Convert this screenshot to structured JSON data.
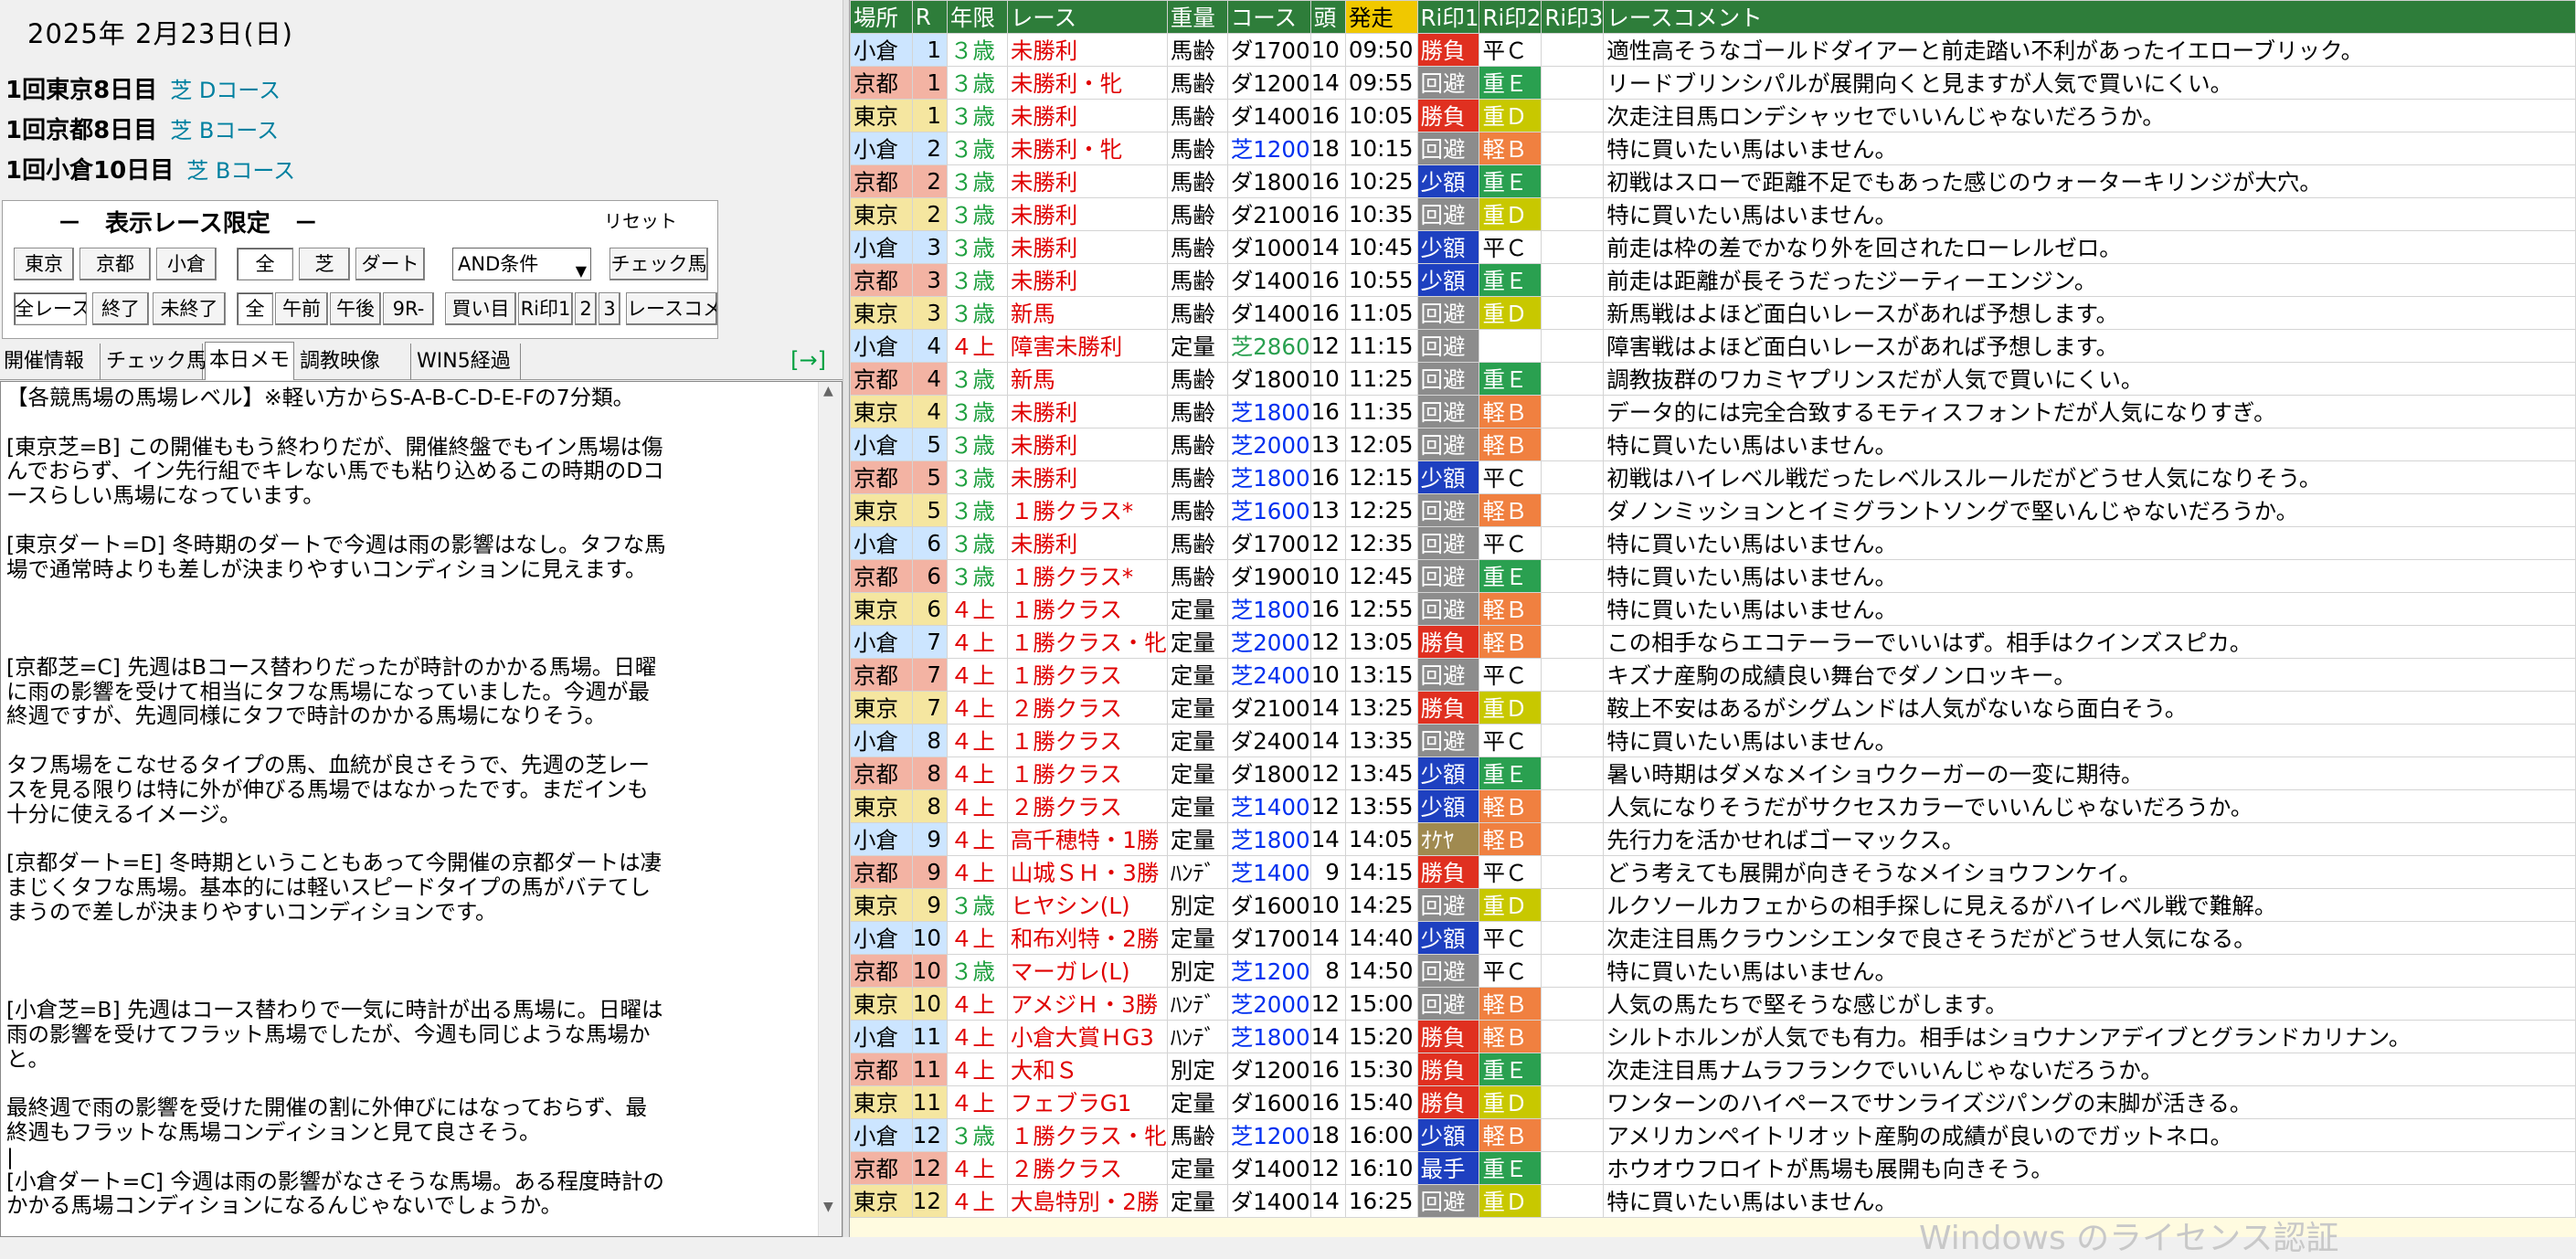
{
  "date": "2025年 2月23日(日)",
  "meetings": [
    {
      "name": "1回東京8日目",
      "course": "芝 Dコース"
    },
    {
      "name": "1回京都8日目",
      "course": "芝 Bコース"
    },
    {
      "name": "1回小倉10日目",
      "course": "芝 Bコース"
    }
  ],
  "filter": {
    "title": "－　表示レース限定　－",
    "reset": "リセット",
    "row1": [
      "東京",
      "京都",
      "小倉",
      "全",
      "芝",
      "ダート"
    ],
    "condition": "AND条件",
    "check_horse": "チェック馬",
    "row2": [
      "全レース",
      "終了",
      "未終了",
      "全",
      "午前",
      "午後",
      "9R-",
      "買い目",
      "Ri印1",
      "2",
      "3",
      "レースコメ"
    ]
  },
  "tabs": [
    "開催情報",
    "チェック馬",
    "本日メモ",
    "調教映像",
    "WIN5経過"
  ],
  "tab_arrow": "[→]",
  "memo": [
    "【各競馬場の馬場レベル】※軽い方からS-A-B-C-D-E-Fの7分類。",
    "",
    "[東京芝=B] この開催ももう終わりだが、開催終盤でもイン馬場は傷",
    "んでおらず、イン先行組でキレない馬でも粘り込めるこの時期のDコ",
    "ースらしい馬場になっています。",
    "",
    "[東京ダート=D] 冬時期のダートで今週は雨の影響はなし。タフな馬",
    "場で通常時よりも差しが決まりやすいコンディションに見えます。",
    "",
    "",
    "",
    "[京都芝=C] 先週はBコース替わりだったが時計のかかる馬場。日曜",
    "に雨の影響を受けて相当にタフな馬場になっていました。今週が最",
    "終週ですが、先週同様にタフで時計のかかる馬場になりそう。",
    "",
    "タフ馬場をこなせるタイプの馬、血統が良さそうで、先週の芝レー",
    "スを見る限りは特に外が伸びる馬場ではなかったです。まだインも",
    "十分に使えるイメージ。",
    "",
    "[京都ダート=E] 冬時期ということもあって今開催の京都ダートは凄",
    "まじくタフな馬場。基本的には軽いスピードタイプの馬がバテてし",
    "まうので差しが決まりやすいコンディションです。",
    "",
    "",
    "",
    "[小倉芝=B] 先週はコース替わりで一気に時計が出る馬場に。日曜は",
    "雨の影響を受けてフラット馬場でしたが、今週も同じような馬場か",
    "と。",
    "",
    "最終週で雨の影響を受けた開催の割に外伸びにはなっておらず、最",
    "終週もフラットな馬場コンディションと見て良さそう。",
    "|",
    "[小倉ダート=C] 今週は雨の影響がなさそうな馬場。ある程度時計の",
    "かかる馬場コンディションになるんじゃないでしょうか。"
  ],
  "table": {
    "headers": [
      "場所",
      "R",
      "年限",
      "レース",
      "重量",
      "コース",
      "頭",
      "発走",
      "Ri印1",
      "Ri印2",
      "Ri印3",
      "レースコメント"
    ],
    "rows": [
      [
        "小倉",
        "1",
        "３歳",
        "未勝利",
        "馬齢",
        "ダ1700",
        "10",
        "09:50",
        "勝負",
        "平Ｃ",
        "",
        "適性高そうなゴールドダイアーと前走踏い不利があったイエローブリック。"
      ],
      [
        "京都",
        "1",
        "３歳",
        "未勝利・牝",
        "馬齢",
        "ダ1200",
        "14",
        "09:55",
        "回避",
        "重Ｅ",
        "",
        "リードブリンシパルが展開向くと見ますが人気で買いにくい。"
      ],
      [
        "東京",
        "1",
        "３歳",
        "未勝利",
        "馬齢",
        "ダ1400",
        "16",
        "10:05",
        "勝負",
        "重Ｄ",
        "",
        "次走注目馬ロンデシャッセでいいんじゃないだろうか。"
      ],
      [
        "小倉",
        "2",
        "３歳",
        "未勝利・牝",
        "馬齢",
        "芝1200",
        "18",
        "10:15",
        "回避",
        "軽Ｂ",
        "",
        "特に買いたい馬はいません。"
      ],
      [
        "京都",
        "2",
        "３歳",
        "未勝利",
        "馬齢",
        "ダ1800",
        "16",
        "10:25",
        "少額",
        "重Ｅ",
        "",
        "初戦はスローで距離不足でもあった感じのウォーターキリンジが大穴。"
      ],
      [
        "東京",
        "2",
        "３歳",
        "未勝利",
        "馬齢",
        "ダ2100",
        "16",
        "10:35",
        "回避",
        "重Ｄ",
        "",
        "特に買いたい馬はいません。"
      ],
      [
        "小倉",
        "3",
        "３歳",
        "未勝利",
        "馬齢",
        "ダ1000",
        "14",
        "10:45",
        "少額",
        "平Ｃ",
        "",
        "前走は枠の差でかなり外を回されたローレルゼロ。"
      ],
      [
        "京都",
        "3",
        "３歳",
        "未勝利",
        "馬齢",
        "ダ1400",
        "16",
        "10:55",
        "少額",
        "重Ｅ",
        "",
        "前走は距離が長そうだったジーティーエンジン。"
      ],
      [
        "東京",
        "3",
        "３歳",
        "新馬",
        "馬齢",
        "ダ1400",
        "16",
        "11:05",
        "回避",
        "重Ｄ",
        "",
        "新馬戦はよほど面白いレースがあれば予想します。"
      ],
      [
        "小倉",
        "4",
        "４上",
        "障害未勝利",
        "定量",
        "芝2860",
        "12",
        "11:15",
        "回避",
        "",
        "",
        "障害戦はよほど面白いレースがあれば予想します。"
      ],
      [
        "京都",
        "4",
        "３歳",
        "新馬",
        "馬齢",
        "ダ1800",
        "10",
        "11:25",
        "回避",
        "重Ｅ",
        "",
        "調教抜群のワカミヤプリンスだが人気で買いにくい。"
      ],
      [
        "東京",
        "4",
        "３歳",
        "未勝利",
        "馬齢",
        "芝1800",
        "16",
        "11:35",
        "回避",
        "軽Ｂ",
        "",
        "データ的には完全合致するモティスフォントだが人気になりすぎ。"
      ],
      [
        "小倉",
        "5",
        "３歳",
        "未勝利",
        "馬齢",
        "芝2000",
        "13",
        "12:05",
        "回避",
        "軽Ｂ",
        "",
        "特に買いたい馬はいません。"
      ],
      [
        "京都",
        "5",
        "３歳",
        "未勝利",
        "馬齢",
        "芝1800",
        "16",
        "12:15",
        "少額",
        "平Ｃ",
        "",
        "初戦はハイレベル戦だったレベルスルールだがどうせ人気になりそう。"
      ],
      [
        "東京",
        "5",
        "３歳",
        "１勝クラス*",
        "馬齢",
        "芝1600",
        "13",
        "12:25",
        "回避",
        "軽Ｂ",
        "",
        "ダノンミッションとイミグラントソングで堅いんじゃないだろうか。"
      ],
      [
        "小倉",
        "6",
        "３歳",
        "未勝利",
        "馬齢",
        "ダ1700",
        "12",
        "12:35",
        "回避",
        "平Ｃ",
        "",
        "特に買いたい馬はいません。"
      ],
      [
        "京都",
        "6",
        "３歳",
        "１勝クラス*",
        "馬齢",
        "ダ1900",
        "10",
        "12:45",
        "回避",
        "重Ｅ",
        "",
        "特に買いたい馬はいません。"
      ],
      [
        "東京",
        "6",
        "４上",
        "１勝クラス",
        "定量",
        "芝1800",
        "16",
        "12:55",
        "回避",
        "軽Ｂ",
        "",
        "特に買いたい馬はいません。"
      ],
      [
        "小倉",
        "7",
        "４上",
        "１勝クラス・牝",
        "定量",
        "芝2000",
        "12",
        "13:05",
        "勝負",
        "軽Ｂ",
        "",
        "この相手ならエコテーラーでいいはず。相手はクインズスピカ。"
      ],
      [
        "京都",
        "7",
        "４上",
        "１勝クラス",
        "定量",
        "芝2400",
        "10",
        "13:15",
        "回避",
        "平Ｃ",
        "",
        "キズナ産駒の成績良い舞台でダノンロッキー。"
      ],
      [
        "東京",
        "7",
        "４上",
        "２勝クラス",
        "定量",
        "ダ2100",
        "14",
        "13:25",
        "勝負",
        "重Ｄ",
        "",
        "鞍上不安はあるがシグムンドは人気がないなら面白そう。"
      ],
      [
        "小倉",
        "8",
        "４上",
        "１勝クラス",
        "定量",
        "ダ2400",
        "14",
        "13:35",
        "回避",
        "平Ｃ",
        "",
        "特に買いたい馬はいません。"
      ],
      [
        "京都",
        "8",
        "４上",
        "１勝クラス",
        "定量",
        "ダ1800",
        "12",
        "13:45",
        "少額",
        "重Ｅ",
        "",
        "暑い時期はダメなメイショウクーガーの一変に期待。"
      ],
      [
        "東京",
        "8",
        "４上",
        "２勝クラス",
        "定量",
        "芝1400",
        "12",
        "13:55",
        "少額",
        "軽Ｂ",
        "",
        "人気になりそうだがサクセスカラーでいいんじゃないだろうか。"
      ],
      [
        "小倉",
        "9",
        "４上",
        "高千穂特・1勝",
        "定量",
        "芝1800",
        "14",
        "14:05",
        "ｵｹﾔ",
        "軽Ｂ",
        "",
        "先行力を活かせればゴーマックス。"
      ],
      [
        "京都",
        "9",
        "４上",
        "山城ＳＨ・3勝",
        "ﾊﾝﾃﾞ",
        "芝1400",
        "9",
        "14:15",
        "勝負",
        "平Ｃ",
        "",
        "どう考えても展開が向きそうなメイショウフンケイ。"
      ],
      [
        "東京",
        "9",
        "３歳",
        "ヒヤシン(L)",
        "別定",
        "ダ1600",
        "10",
        "14:25",
        "回避",
        "重Ｄ",
        "",
        "ルクソールカフェからの相手探しに見えるがハイレベル戦で難解。"
      ],
      [
        "小倉",
        "10",
        "４上",
        "和布刈特・2勝",
        "定量",
        "ダ1700",
        "14",
        "14:40",
        "少額",
        "平Ｃ",
        "",
        "次走注目馬クラウンシエンタで良さそうだがどうせ人気になる。"
      ],
      [
        "京都",
        "10",
        "３歳",
        "マーガレ(L)",
        "別定",
        "芝1200",
        "8",
        "14:50",
        "回避",
        "平Ｃ",
        "",
        "特に買いたい馬はいません。"
      ],
      [
        "東京",
        "10",
        "４上",
        "アメジＨ・3勝",
        "ﾊﾝﾃﾞ",
        "芝2000",
        "12",
        "15:00",
        "回避",
        "軽Ｂ",
        "",
        "人気の馬たちで堅そうな感じがします。"
      ],
      [
        "小倉",
        "11",
        "４上",
        "小倉大賞ＨG3",
        "ﾊﾝﾃﾞ",
        "芝1800",
        "14",
        "15:20",
        "勝負",
        "軽Ｂ",
        "",
        "シルトホルンが人気でも有力。相手はショウナンアデイブとグランドカリナン。"
      ],
      [
        "京都",
        "11",
        "４上",
        "大和Ｓ",
        "別定",
        "ダ1200",
        "16",
        "15:30",
        "勝負",
        "重Ｅ",
        "",
        "次走注目馬ナムラフランクでいいんじゃないだろうか。"
      ],
      [
        "東京",
        "11",
        "４上",
        "フェブラG1",
        "定量",
        "ダ1600",
        "16",
        "15:40",
        "勝負",
        "重Ｄ",
        "",
        "ワンターンのハイペースでサンライズジパングの末脚が活きる。"
      ],
      [
        "小倉",
        "12",
        "３歳",
        "１勝クラス・牝",
        "馬齢",
        "芝1200",
        "18",
        "16:00",
        "少額",
        "軽Ｂ",
        "",
        "アメリカンペイトリオット産駒の成績が良いのでガットネロ。"
      ],
      [
        "京都",
        "12",
        "４上",
        "２勝クラス",
        "定量",
        "ダ1400",
        "12",
        "16:10",
        "最手",
        "重Ｅ",
        "",
        "ホウオウフロイトが馬場も展開も向きそう。"
      ],
      [
        "東京",
        "12",
        "４上",
        "大島特別・2勝",
        "定量",
        "ダ1400",
        "14",
        "16:25",
        "回避",
        "重Ｄ",
        "",
        "特に買いたい馬はいません。"
      ]
    ]
  },
  "watermark": "Windows のライセンス認証",
  "colors": {
    "header_bg": "#2e7d3a",
    "tokyo": "#f5e6a0",
    "kyoto": "#f3b3a3",
    "kokura": "#cce5ff",
    "shobu": "#e03020",
    "kaihi": "#8c8c8c",
    "shogaku": "#1e40c0",
    "oke": "#a08a50",
    "mark_C": "#ffffff",
    "mark_B": "#f08040",
    "mark_E": "#2aa050",
    "mark_D": "#c8c800"
  }
}
